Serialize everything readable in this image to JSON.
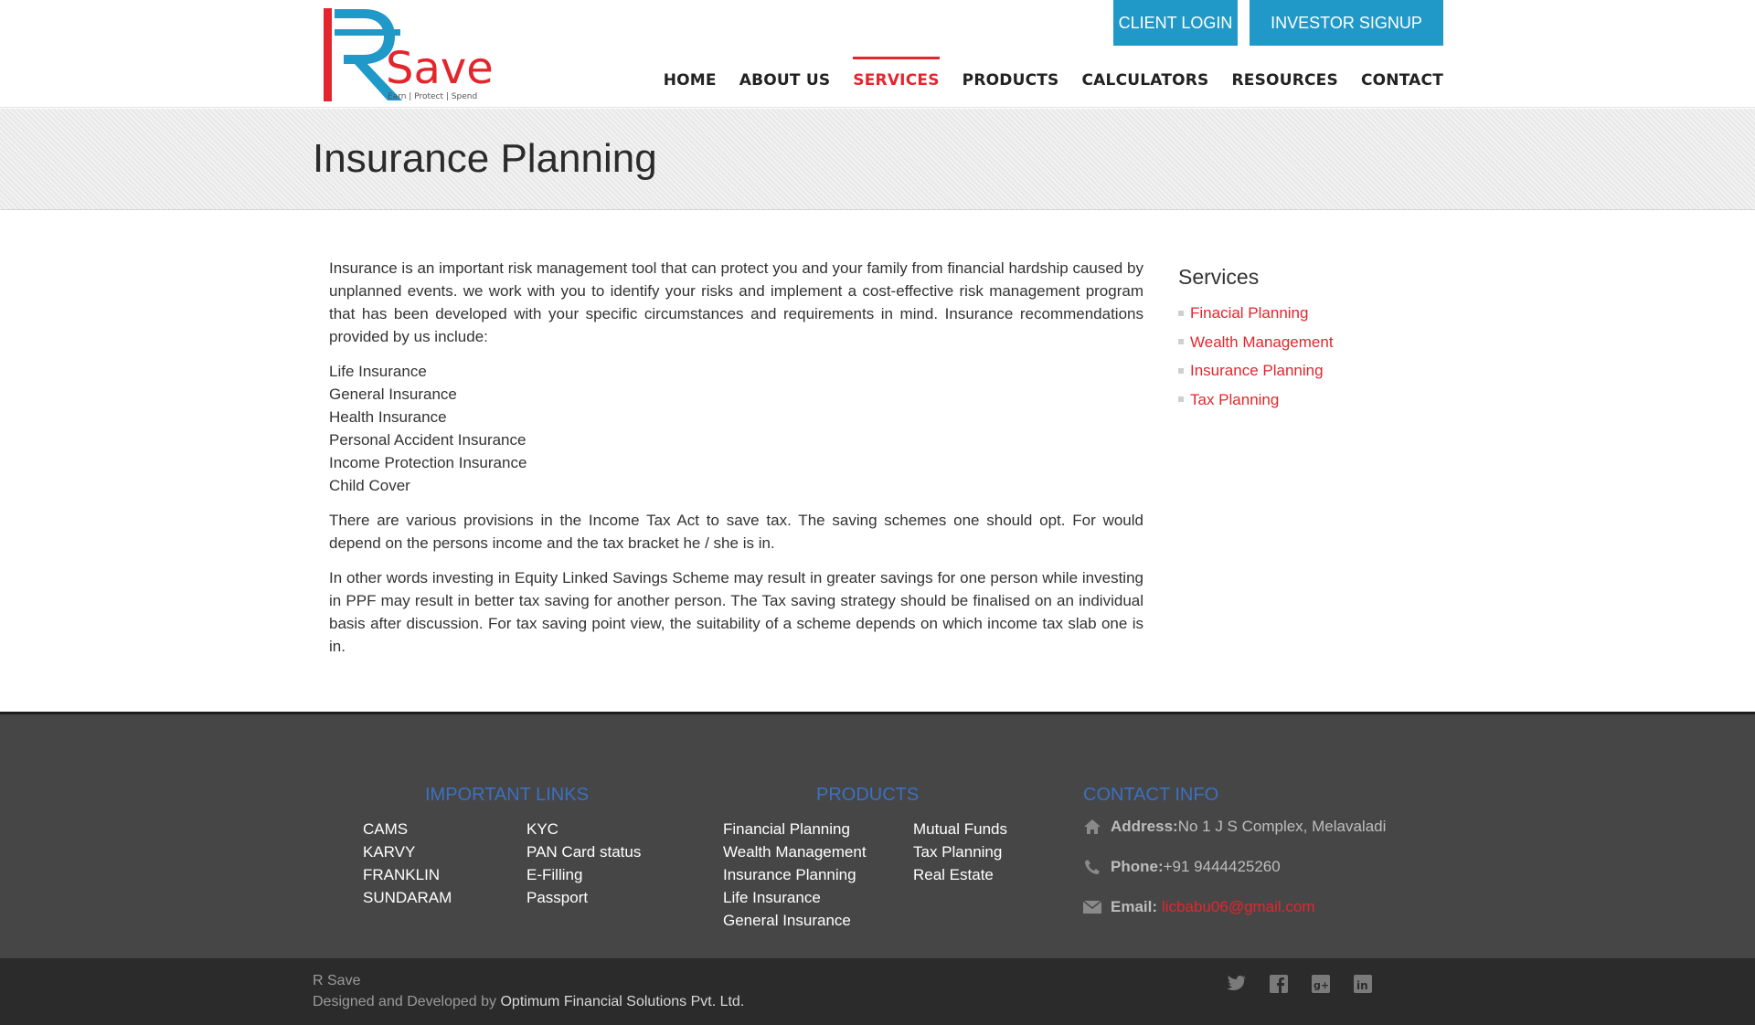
{
  "header": {
    "logo": {
      "text": "Save",
      "tagline": "Earn | Protect | Spend",
      "brand_red": "#e3262d",
      "brand_blue": "#2199c8"
    },
    "buttons": {
      "client_login": "CLIENT LOGIN",
      "investor_signup": "INVESTOR SIGNUP"
    },
    "nav": [
      {
        "label": "HOME",
        "active": false
      },
      {
        "label": "ABOUT US",
        "active": false
      },
      {
        "label": "SERVICES",
        "active": true
      },
      {
        "label": "PRODUCTS",
        "active": false
      },
      {
        "label": "CALCULATORS",
        "active": false
      },
      {
        "label": "RESOURCES",
        "active": false
      },
      {
        "label": "CONTACT",
        "active": false
      }
    ]
  },
  "page": {
    "title": "Insurance Planning"
  },
  "main": {
    "intro": "Insurance is an important risk management tool that can protect you and your family from financial hardship caused by unplanned events. we work with you to identify your risks and implement a cost-effective risk management program that has been developed with your specific circumstances and requirements in mind. Insurance recommendations provided by us include:",
    "insurance_types": [
      "Life Insurance",
      "General Insurance",
      "Health Insurance",
      "Personal Accident Insurance",
      "Income Protection Insurance",
      "Child Cover"
    ],
    "para2": "There are various provisions in the Income Tax Act to save tax. The saving schemes one should opt. For would depend on the persons income and the tax bracket he / she is in.",
    "para3": "In other words investing in Equity Linked Savings Scheme may result in greater savings for one person while investing in PPF may result in better tax saving for another person. The Tax saving strategy should be finalised on an individual basis after discussion. For tax saving point view, the suitability of a scheme depends on which income tax slab one is in."
  },
  "sidebar": {
    "heading": "Services",
    "links": [
      "Finacial Planning",
      "Wealth Management",
      "Insurance Planning",
      "Tax Planning"
    ]
  },
  "footer": {
    "important_links": {
      "heading": "IMPORTANT LINKS",
      "col1": [
        "CAMS",
        "KARVY",
        "FRANKLIN",
        "SUNDARAM"
      ],
      "col2": [
        "KYC",
        "PAN Card status",
        "E-Filling",
        "Passport"
      ]
    },
    "products": {
      "heading": "PRODUCTS",
      "col1": [
        "Financial Planning",
        "Wealth Management",
        "Insurance Planning",
        "Life Insurance",
        "General Insurance"
      ],
      "col2": [
        "Mutual Funds",
        "Tax Planning",
        "Real Estate"
      ]
    },
    "contact": {
      "heading": "CONTACT INFO",
      "address_label": "Address:",
      "address_value": "No 1 J S Complex, Melavaladi",
      "phone_label": "Phone:",
      "phone_value": "+91 9444425260",
      "email_label": "Email:",
      "email_value": "licbabu06@gmail.com",
      "icons": [
        "home-icon",
        "phone-icon",
        "envelope-icon"
      ]
    }
  },
  "bottom": {
    "site_name": "R Save",
    "designed_prefix": "Designed and Developed by ",
    "developer": "Optimum Financial Solutions Pvt. Ltd.",
    "social": [
      "twitter-icon",
      "facebook-icon",
      "google-plus-icon",
      "linkedin-icon"
    ]
  }
}
